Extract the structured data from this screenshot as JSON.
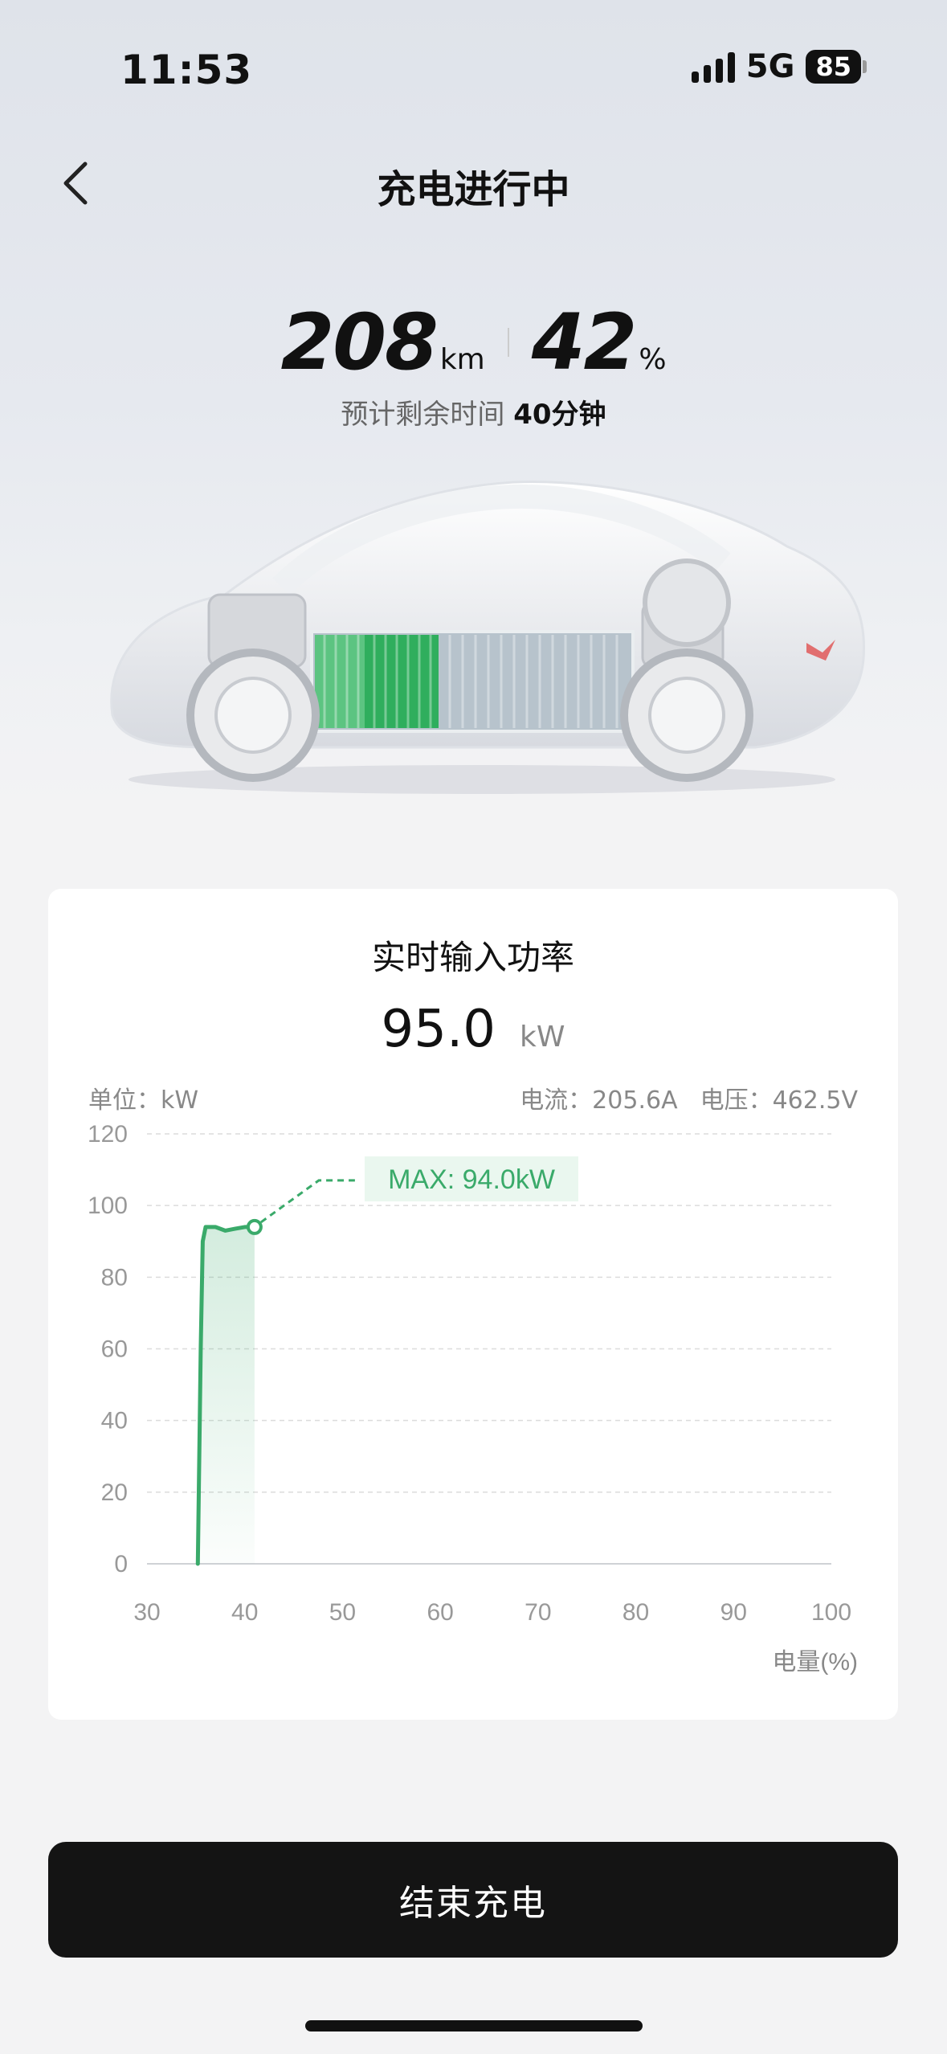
{
  "status_bar": {
    "time": "11:53",
    "network": "5G",
    "battery": "85"
  },
  "header": {
    "title": "充电进行中"
  },
  "stats": {
    "range_value": "208",
    "range_unit": "km",
    "soc_value": "42",
    "soc_unit": "%"
  },
  "remaining": {
    "label": "预计剩余时间",
    "value": "40分钟"
  },
  "card": {
    "title": "实时输入功率",
    "power_value": "95.0",
    "power_unit": "kW",
    "unit_label": "单位：kW",
    "current_label": "电流：205.6A",
    "voltage_label": "电压：462.5V"
  },
  "chart_data": {
    "type": "line",
    "ylabel": "单位：kW",
    "xlabel": "电量(%)",
    "xlim": [
      30,
      100
    ],
    "ylim": [
      0,
      120
    ],
    "x_ticks": [
      "30",
      "40",
      "50",
      "60",
      "70",
      "80",
      "90",
      "100"
    ],
    "y_ticks": [
      "0",
      "20",
      "40",
      "60",
      "80",
      "100",
      "120"
    ],
    "grid": true,
    "series": [
      {
        "x": [
          35.2,
          35.5,
          35.7,
          36.0,
          37.0,
          38.0,
          39.0,
          40.0,
          41.0
        ],
        "y": [
          0,
          60,
          90,
          94,
          94,
          93,
          93.5,
          94,
          94
        ]
      }
    ],
    "annotation": "MAX: 94.0kW",
    "color": "#3aaa6a"
  },
  "footer": {
    "end_button": "结束充电"
  }
}
